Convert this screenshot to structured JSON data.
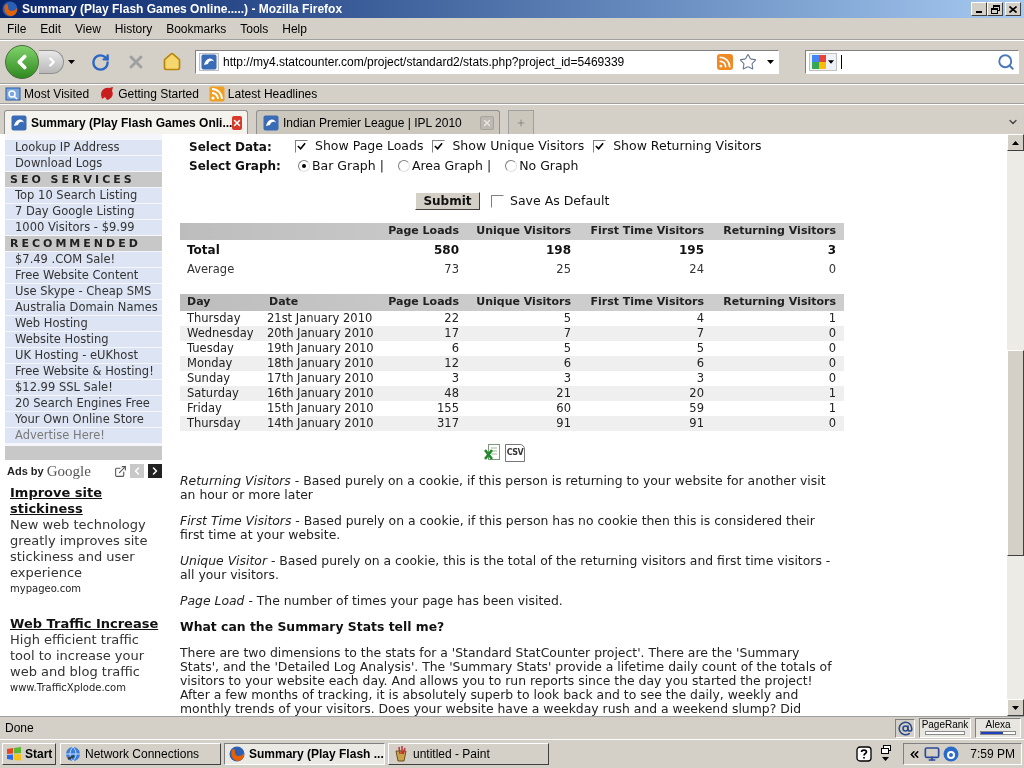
{
  "window": {
    "title": "Summary (Play Flash Games Online.....) - Mozilla Firefox"
  },
  "menu_bar": [
    "File",
    "Edit",
    "View",
    "History",
    "Bookmarks",
    "Tools",
    "Help"
  ],
  "address_bar": {
    "value": "http://my4.statcounter.com/project/standard2/stats.php?project_id=5469339"
  },
  "bookmarks": [
    "Most Visited",
    "Getting Started",
    "Latest Headlines"
  ],
  "tabs": [
    {
      "label": "Summary (Play Flash Games Onli...",
      "selected": true
    },
    {
      "label": "Indian Premier League | IPL 2010",
      "selected": false
    }
  ],
  "sidebar": {
    "items": [
      {
        "kind": "link",
        "label": "Lookup IP Address"
      },
      {
        "kind": "link",
        "label": "Download Logs"
      },
      {
        "kind": "header",
        "label": "SEO SERVICES"
      },
      {
        "kind": "link",
        "label": "Top 10 Search Listing"
      },
      {
        "kind": "link",
        "label": "7 Day Google Listing"
      },
      {
        "kind": "link",
        "label": "1000 Visitors - $9.99"
      },
      {
        "kind": "header",
        "label": "RECOMMENDED"
      },
      {
        "kind": "link",
        "label": "$7.49 .COM Sale!"
      },
      {
        "kind": "link",
        "label": "Free Website Content"
      },
      {
        "kind": "link",
        "label": "Use Skype - Cheap SMS"
      },
      {
        "kind": "link",
        "label": "Australia Domain Names"
      },
      {
        "kind": "link",
        "label": "Web Hosting"
      },
      {
        "kind": "link",
        "label": "Website Hosting"
      },
      {
        "kind": "link",
        "label": "UK Hosting - eUKhost"
      },
      {
        "kind": "link",
        "label": "Free Website & Hosting!"
      },
      {
        "kind": "link",
        "label": "$12.99 SSL Sale!"
      },
      {
        "kind": "link",
        "label": "20 Search Engines Free"
      },
      {
        "kind": "link",
        "label": "Your Own Online Store"
      },
      {
        "kind": "promo",
        "label": "Advertise Here!"
      }
    ]
  },
  "ads": {
    "label": "Ads by",
    "brand": "Google",
    "items": [
      {
        "title": "Improve site stickiness",
        "text": "New web technology greatly improves site stickiness and user experience",
        "url": "mypageo.com"
      },
      {
        "title": "Web Traffic Increase",
        "text": "High efficient traffic tool to increase your web and blog traffic",
        "url": "www.TrafficXplode.com"
      }
    ]
  },
  "form": {
    "select_data": {
      "label": "Select Data:",
      "options": [
        {
          "label": "Show Page Loads",
          "checked": true
        },
        {
          "label": "Show Unique Visitors",
          "checked": true
        },
        {
          "label": "Show Returning Visitors",
          "checked": true
        }
      ]
    },
    "select_graph": {
      "label": "Select Graph:",
      "options": [
        {
          "label": "Bar Graph |",
          "selected": true
        },
        {
          "label": "Area Graph |",
          "selected": false
        },
        {
          "label": "No Graph",
          "selected": false
        }
      ]
    },
    "submit": "Submit",
    "save_default": {
      "label": "Save As Default",
      "checked": false
    }
  },
  "summary_table": {
    "columns": [
      "Page Loads",
      "Unique Visitors",
      "First Time Visitors",
      "Returning Visitors"
    ],
    "rows": [
      {
        "kind": "total",
        "label": "Total",
        "cells": [
          "580",
          "198",
          "195",
          "3"
        ]
      },
      {
        "kind": "average",
        "label": "Average",
        "cells": [
          "73",
          "25",
          "24",
          "0"
        ]
      }
    ]
  },
  "daily_table": {
    "columns": [
      "Day",
      "Date",
      "Page Loads",
      "Unique Visitors",
      "First Time Visitors",
      "Returning Visitors"
    ],
    "rows": [
      [
        "Thursday",
        "21st January 2010",
        "22",
        "5",
        "4",
        "1"
      ],
      [
        "Wednesday",
        "20th January 2010",
        "17",
        "7",
        "7",
        "0"
      ],
      [
        "Tuesday",
        "19th January 2010",
        "6",
        "5",
        "5",
        "0"
      ],
      [
        "Monday",
        "18th January 2010",
        "12",
        "6",
        "6",
        "0"
      ],
      [
        "Sunday",
        "17th January 2010",
        "3",
        "3",
        "3",
        "0"
      ],
      [
        "Saturday",
        "16th January 2010",
        "48",
        "21",
        "20",
        "1"
      ],
      [
        "Friday",
        "15th January 2010",
        "155",
        "60",
        "59",
        "1"
      ],
      [
        "Thursday",
        "14th January 2010",
        "317",
        "91",
        "91",
        "0"
      ]
    ]
  },
  "export": {
    "csv": "CSV"
  },
  "definitions": [
    "*Returning Visitors* - Based purely on a cookie, if this person is returning to your website for another visit an hour or more later",
    "*First Time Visitors* - Based purely on a cookie, if this person has no cookie then this is considered their first time at your website.",
    "*Unique Visitor* - Based purely on a cookie, this is the total of the returning visitors and first time visitors - all your visitors.",
    "*Page Load* - The number of times your page has been visited."
  ],
  "heading": "What can the Summary Stats tell me?",
  "paragraph": "There are two dimensions to the stats for a 'Standard StatCounter project'. There are the 'Summary Stats', and the 'Detailed Log Analysis'. The 'Summary Stats' provide a lifetime daily count of the totals of visitors to your website each day. And allows you to run reports since the day you started the project! After a few months of tracking, it is absolutely superb to look back and to see the daily, weekly and monthly trends of your visitors. Does your website have a weekday rush and a weekend slump? Did",
  "status_bar": {
    "text": "Done",
    "pagerank": "PageRank",
    "alexa": "Alexa"
  },
  "taskbar": {
    "start": "Start",
    "tasks": [
      {
        "label": "Network Connections",
        "selected": false
      },
      {
        "label": "Summary (Play Flash ...",
        "selected": true
      },
      {
        "label": "untitled - Paint",
        "selected": false
      }
    ],
    "clock": "7:59 PM"
  }
}
